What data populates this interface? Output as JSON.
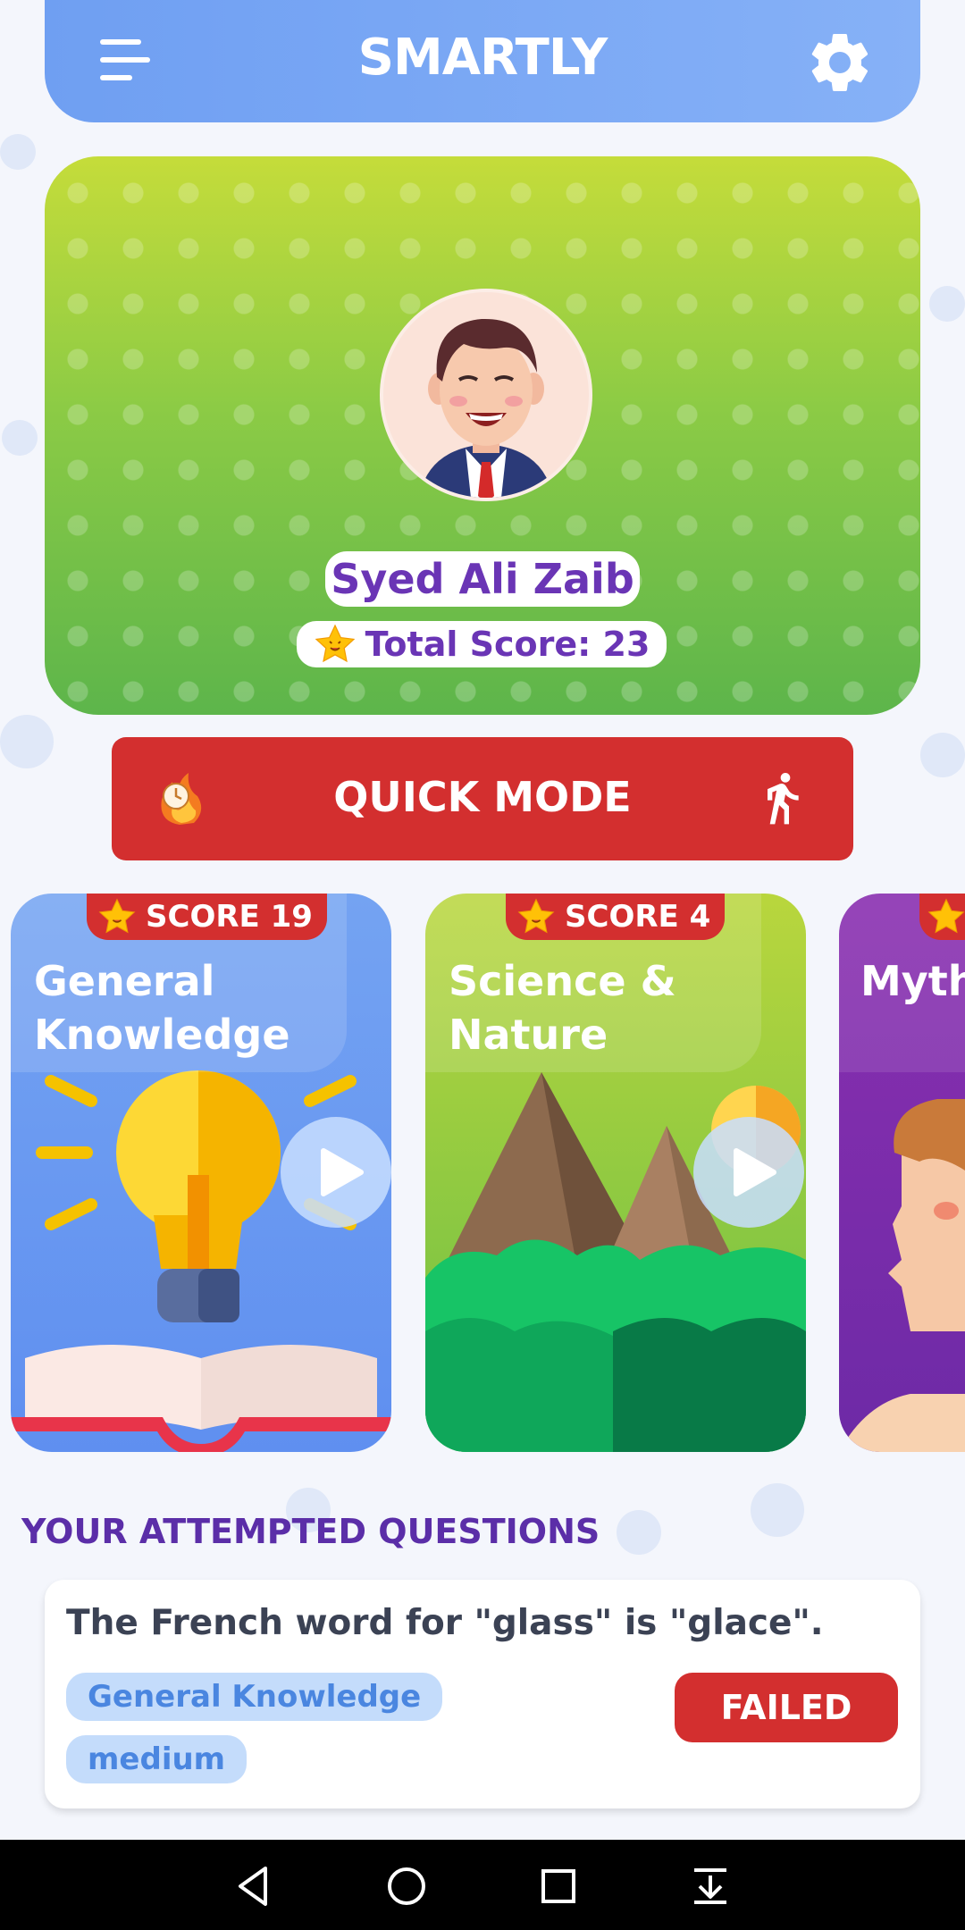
{
  "app": {
    "title": "SMARTLY"
  },
  "icons": {
    "menu": "menu-icon",
    "settings": "gear-icon",
    "star": "star-face-icon",
    "timer": "fire-clock-icon",
    "runner": "running-man-icon",
    "play": "play-icon"
  },
  "profile": {
    "name": "Syed Ali Zaib",
    "score_label": "Total Score: 23"
  },
  "quick_mode": {
    "label": "QUICK MODE"
  },
  "categories": [
    {
      "score_label": "SCORE 19",
      "title_line1": "General",
      "title_line2": "Knowledge"
    },
    {
      "score_label": "SCORE 4",
      "title_line1": "Science &",
      "title_line2": "Nature"
    },
    {
      "score_label": "",
      "title_line1": "Myth",
      "title_line2": ""
    }
  ],
  "attempted": {
    "heading": "YOUR ATTEMPTED QUESTIONS",
    "questions": [
      {
        "text": "The French word for \"glass\" is \"glace\".",
        "category": "General Knowledge",
        "difficulty": "medium",
        "status": "FAILED"
      }
    ]
  },
  "colors": {
    "header": "#7aa7f5",
    "accent_red": "#d32f2f",
    "purple": "#6a35b5",
    "card_general": "#78a6f3",
    "card_science": "#8bc34a",
    "card_myth": "#7b2fa8"
  },
  "navbar": {
    "back": "back-icon",
    "home": "home-icon",
    "recents": "recents-icon",
    "download": "download-icon"
  }
}
